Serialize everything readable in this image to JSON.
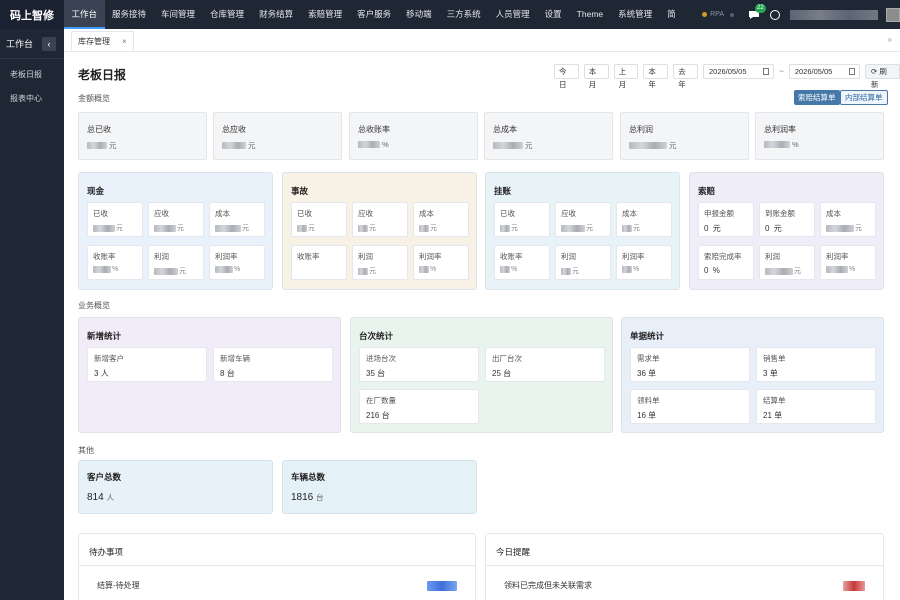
{
  "app": {
    "logo": "码上智修"
  },
  "topnav": {
    "items": [
      "工作台",
      "服务接待",
      "车间管理",
      "仓库管理",
      "财务结算",
      "索赔管理",
      "客户服务",
      "移动端",
      "三方系统",
      "人员管理",
      "设置",
      "Theme",
      "系统管理",
      "简"
    ],
    "rpa": "RPA",
    "message_count": "22"
  },
  "sidebar": {
    "title": "工作台",
    "items": [
      "老板日报",
      "报表中心"
    ]
  },
  "tabs": [
    {
      "label": "库存管理"
    }
  ],
  "page": {
    "title": "老板日报"
  },
  "toolbar": {
    "quick": [
      "今日",
      "本月",
      "上月",
      "本年",
      "去年"
    ],
    "date_start": "2026/05/05",
    "date_end": "2026/05/05",
    "tilde": "~",
    "refresh": "刷新"
  },
  "amount": {
    "label": "金额概览",
    "buttons": [
      "索赔结算单",
      "内部结算单"
    ],
    "cards": [
      {
        "label": "总已收",
        "unit": "元"
      },
      {
        "label": "总应收",
        "unit": "元"
      },
      {
        "label": "总收账率",
        "unit": "%"
      },
      {
        "label": "总成本",
        "unit": "元"
      },
      {
        "label": "总利润",
        "unit": "元"
      },
      {
        "label": "总利润率",
        "unit": "%"
      }
    ]
  },
  "groups": [
    {
      "title": "现金",
      "bg": "#e9f1fb",
      "items": [
        {
          "label": "已收",
          "unit": "元"
        },
        {
          "label": "应收",
          "unit": "元"
        },
        {
          "label": "成本",
          "unit": "元"
        },
        {
          "label": "收账率",
          "unit": "%"
        },
        {
          "label": "利润",
          "unit": "元"
        },
        {
          "label": "利润率",
          "unit": "%"
        }
      ]
    },
    {
      "title": "事故",
      "bg": "#f8f1e6",
      "items": [
        {
          "label": "已收",
          "unit": "元"
        },
        {
          "label": "应收",
          "unit": "元"
        },
        {
          "label": "成本",
          "unit": "元"
        },
        {
          "label": "收账率",
          "unit": "%"
        },
        {
          "label": "利润",
          "unit": "元"
        },
        {
          "label": "利润率",
          "unit": "%"
        }
      ]
    },
    {
      "title": "挂账",
      "bg": "#e8f3f8",
      "items": [
        {
          "label": "已收",
          "unit": "元"
        },
        {
          "label": "应收",
          "unit": "元"
        },
        {
          "label": "成本",
          "unit": "元"
        },
        {
          "label": "收账率",
          "unit": "%"
        },
        {
          "label": "利润",
          "unit": "元"
        },
        {
          "label": "利润率",
          "unit": "%"
        }
      ]
    },
    {
      "title": "索赔",
      "bg": "#efedf8",
      "items": [
        {
          "label": "申报金额",
          "value": "0",
          "unit": "元"
        },
        {
          "label": "到账金额",
          "value": "0",
          "unit": "元"
        },
        {
          "label": "成本",
          "unit": "元"
        },
        {
          "label": "索赔完成率",
          "value": "0",
          "unit": "%"
        },
        {
          "label": "利润",
          "unit": "元"
        },
        {
          "label": "利润率",
          "unit": "%"
        }
      ]
    }
  ],
  "business": {
    "label": "业务概览",
    "groups": [
      {
        "title": "新增统计",
        "bg": "#f1ecf8",
        "items": [
          {
            "label": "新增客户",
            "value": "3",
            "unit": "人"
          },
          {
            "label": "新增车辆",
            "value": "8",
            "unit": "台"
          }
        ]
      },
      {
        "title": "台次统计",
        "bg": "#e9f4ee",
        "items": [
          {
            "label": "进场台次",
            "value": "35",
            "unit": "台"
          },
          {
            "label": "出厂台次",
            "value": "25",
            "unit": "台"
          },
          {
            "label": "在厂数量",
            "value": "216",
            "unit": "台"
          }
        ]
      },
      {
        "title": "单据统计",
        "bg": "#e8eff9",
        "items": [
          {
            "label": "需求单",
            "value": "36",
            "unit": "单"
          },
          {
            "label": "销售单",
            "value": "3",
            "unit": "单"
          },
          {
            "label": "领料单",
            "value": "16",
            "unit": "单"
          },
          {
            "label": "结算单",
            "value": "21",
            "unit": "单"
          }
        ]
      }
    ]
  },
  "others": {
    "label": "其他",
    "cards": [
      {
        "label": "客户总数",
        "value": "814",
        "unit": "人",
        "bg": "#e6f2f8"
      },
      {
        "label": "车辆总数",
        "value": "1816",
        "unit": "台",
        "bg": "#e4f1f6"
      }
    ]
  },
  "todo": {
    "title": "待办事项",
    "row": "结算-待处理",
    "tag_color": "#4a7fe0"
  },
  "remind": {
    "title": "今日提醒",
    "row": "领料已完成但未关联需求",
    "tag_color": "#c9383a"
  }
}
